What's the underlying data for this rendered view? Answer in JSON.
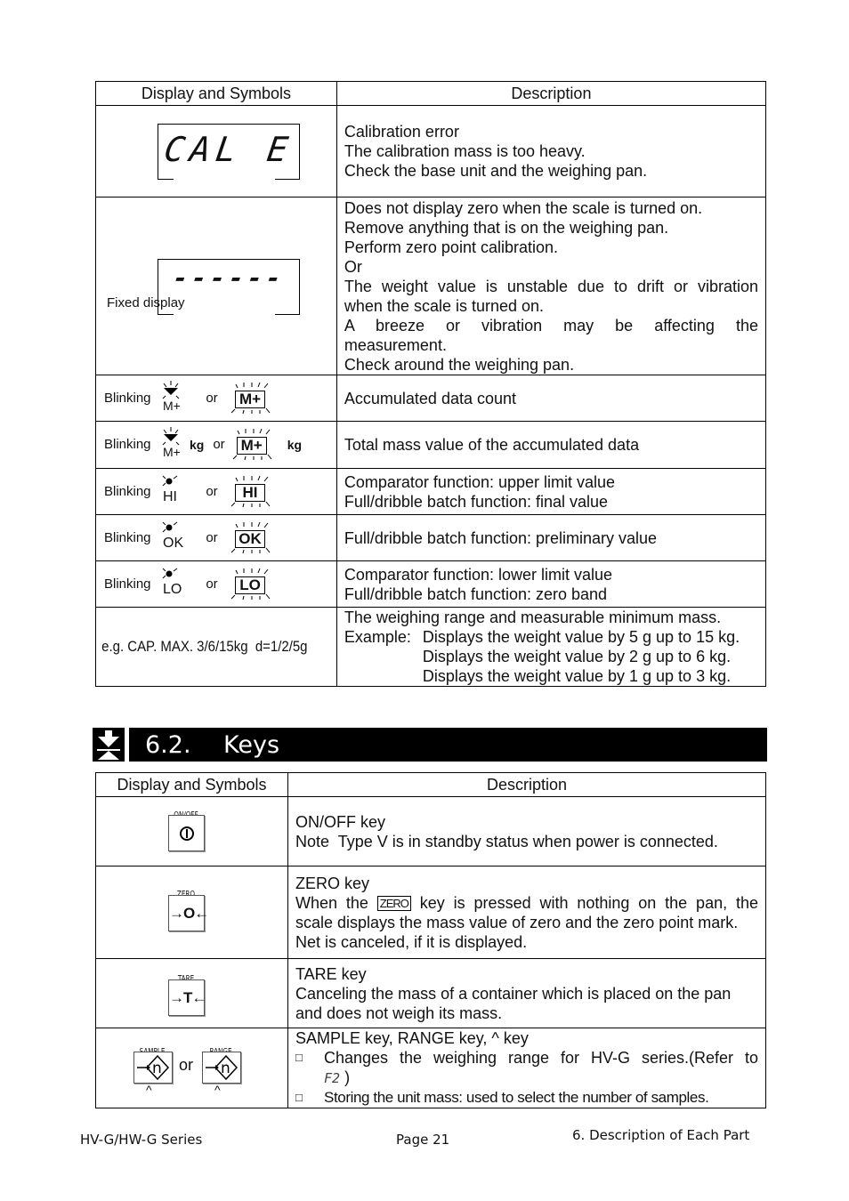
{
  "table_display": {
    "headers": [
      "Display and Symbols",
      "Description"
    ],
    "rows": [
      {
        "symbol": {
          "type": "lcd",
          "text": "CAL E"
        },
        "lines": [
          "Calibration error",
          "The calibration mass is too heavy.",
          "Check the base unit and the weighing pan."
        ]
      },
      {
        "symbol": {
          "type": "lcd",
          "text": "------",
          "label": "Fixed display"
        },
        "lines": [
          "Does not display zero when the scale is turned on.",
          "Remove anything that is on the weighing pan.",
          "Perform zero point calibration.",
          "Or",
          "The weight value is unstable due to drift or vibration",
          "when the scale is turned on.",
          "A breeze or vibration may be affecting the",
          "measurement.",
          "Check around the weighing pan."
        ]
      },
      {
        "symbol": {
          "type": "blink",
          "prefix": "Blinking",
          "annunciator": "M+",
          "or": "or",
          "box": "M+"
        },
        "lines": [
          "Accumulated data count"
        ]
      },
      {
        "symbol": {
          "type": "blink",
          "prefix": "Blinking",
          "annunciator": "M+",
          "unit": "kg",
          "or": "or",
          "box": "M+"
        },
        "lines": [
          "Total mass value of the accumulated data"
        ]
      },
      {
        "symbol": {
          "type": "blink",
          "prefix": "Blinking",
          "annunciator": "HI",
          "or": "or",
          "box": "HI"
        },
        "lines": [
          "Comparator function: upper limit value",
          "Full/dribble batch function: final value"
        ]
      },
      {
        "symbol": {
          "type": "blink",
          "prefix": "Blinking",
          "annunciator": "OK",
          "or": "or",
          "box": "OK"
        },
        "lines": [
          "Full/dribble batch function: preliminary value"
        ]
      },
      {
        "symbol": {
          "type": "blink",
          "prefix": "Blinking",
          "annunciator": "LO",
          "or": "or",
          "box": "LO"
        },
        "lines": [
          "Comparator function: lower limit value",
          "Full/dribble batch function: zero band"
        ]
      },
      {
        "symbol": {
          "type": "text",
          "text": "e.g. CAP. MAX. 3/6/15kg  d=1/2/5g"
        },
        "intro": "The weighing range and measurable minimum mass.",
        "example_label": "Example:",
        "examples": [
          "Displays the weight value by 5 g up to 15 kg.",
          "Displays the weight value by 2 g up to 6 kg.",
          "Displays the weight value by 1 g up to 3 kg."
        ]
      }
    ]
  },
  "section": {
    "icon": "down-arrow-section-icon",
    "number": "6.2.",
    "title": "Keys"
  },
  "table_keys": {
    "headers": [
      "Display and Symbols",
      "Description"
    ],
    "rows": [
      {
        "key": {
          "label": "ON/OFF",
          "glyph": "power-icon"
        },
        "title": "ON/OFF key",
        "lines": [
          "Note  Type V is in standby status when power is connected."
        ]
      },
      {
        "key": {
          "label": "ZERO",
          "glyph": "→O←"
        },
        "title": "ZERO key",
        "line1_before": "When the",
        "inline_key": "ZERO",
        "line1_after": "key is pressed with nothing on the pan, the",
        "lines": [
          "scale displays the mass value of zero and the zero point mark.",
          "Net is canceled, if it is displayed."
        ]
      },
      {
        "key": {
          "label": "TARE",
          "glyph": "→T←"
        },
        "title": "TARE key",
        "lines": [
          "Canceling the mass of a container which is placed on the pan",
          "and does not weigh its mass."
        ]
      },
      {
        "keys": [
          {
            "label": "SAMPLE",
            "glyph": "→n",
            "sub": "^"
          },
          {
            "label": "RANGE",
            "glyph": "→n",
            "sub": "^"
          }
        ],
        "or": "or",
        "title": "SAMPLE key, RANGE key, ^ key",
        "bullets": [
          {
            "text": "Changes the weighing range for HV-G series.(Refer to",
            "cont_code": "F2",
            "cont_after": ")"
          },
          {
            "text": "Storing the unit mass: used to select the number of samples."
          }
        ]
      }
    ]
  },
  "footer": {
    "left": "HV-G/HW-G Series",
    "center": "Page 21",
    "right": "6. Description of Each Part"
  }
}
